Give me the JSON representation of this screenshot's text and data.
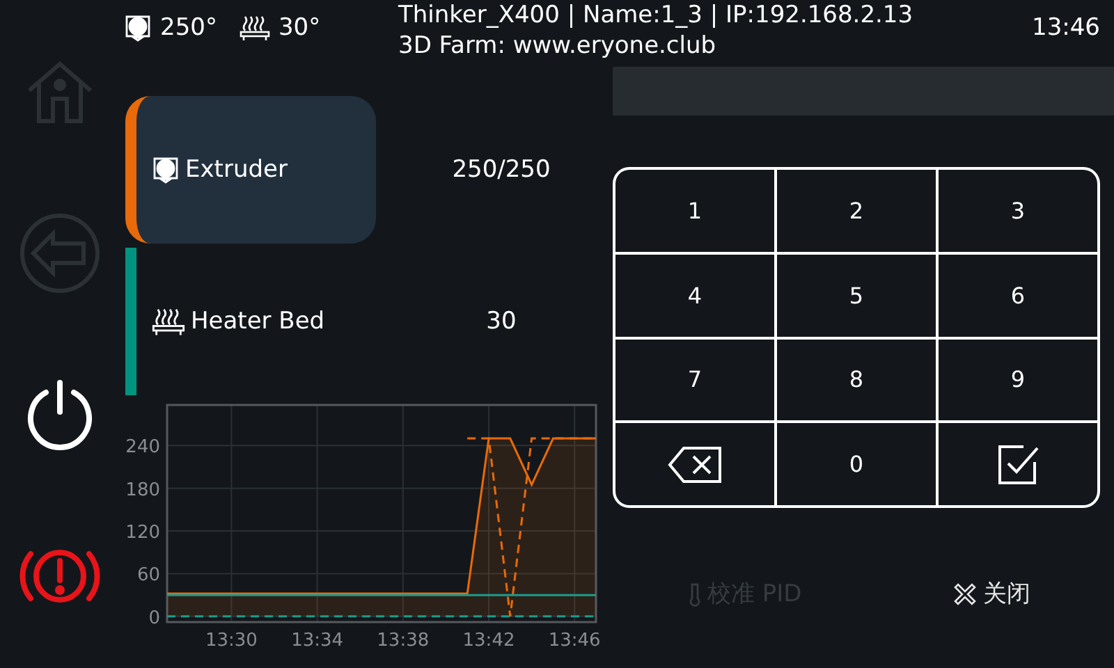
{
  "status_bar": {
    "extruder_temp": "250°",
    "bed_temp": "30°",
    "title": "Thinker_X400 | Name:1_3 | IP:192.168.2.13",
    "subtitle": "3D Farm: www.eryone.club",
    "time": "13:46"
  },
  "sidebar": [
    {
      "kind": "home",
      "disabled": true
    },
    {
      "kind": "back",
      "disabled": true
    },
    {
      "kind": "power",
      "disabled": false
    },
    {
      "kind": "emergency",
      "disabled": false
    }
  ],
  "heaters": [
    {
      "kind": "extruder",
      "name": "Extruder",
      "value": "250/250",
      "selected": true,
      "color": "#e86a0a"
    },
    {
      "kind": "bed",
      "name": "Heater Bed",
      "value": "30",
      "selected": false,
      "color": "#009480"
    }
  ],
  "chart": {
    "chart_data": {
      "type": "line",
      "grid": true,
      "categories": [
        null,
        null,
        null,
        "13:30",
        null,
        null,
        null,
        "13:34",
        null,
        null,
        null,
        "13:38",
        null,
        null,
        null,
        "13:42",
        null,
        null,
        null,
        "13:46",
        null
      ],
      "ylim": [
        -8,
        297
      ],
      "yticks": [
        0,
        60,
        120,
        180,
        240
      ],
      "series": [
        {
          "color": "#e86a0a",
          "type": "area",
          "values": [
            32,
            32,
            32,
            32,
            32,
            32,
            32,
            32,
            32,
            32,
            32,
            32,
            32,
            32,
            32,
            250,
            250,
            185,
            250,
            250,
            250
          ]
        },
        {
          "color": "#e86a0a",
          "line_style": "dashed",
          "values": [
            null,
            null,
            null,
            null,
            null,
            null,
            null,
            null,
            null,
            null,
            null,
            null,
            null,
            null,
            250,
            250,
            0,
            250,
            250,
            250,
            250
          ]
        },
        {
          "color": "#1a9c8c",
          "values": [
            30,
            30,
            30,
            30,
            30,
            30,
            30,
            30,
            30,
            30,
            30,
            30,
            30,
            30,
            30,
            30,
            30,
            30,
            30,
            30,
            30
          ]
        },
        {
          "color": "#1a9c8c",
          "line_style": "dashed",
          "values": [
            0,
            0,
            0,
            0,
            0,
            0,
            0,
            0,
            0,
            0,
            0,
            0,
            0,
            0,
            0,
            0,
            0,
            0,
            0,
            0,
            0
          ]
        }
      ]
    }
  },
  "keypad": [
    {
      "kind": "digit",
      "label": "1"
    },
    {
      "kind": "digit",
      "label": "2"
    },
    {
      "kind": "digit",
      "label": "3"
    },
    {
      "kind": "digit",
      "label": "4"
    },
    {
      "kind": "digit",
      "label": "5"
    },
    {
      "kind": "digit",
      "label": "6"
    },
    {
      "kind": "digit",
      "label": "7"
    },
    {
      "kind": "digit",
      "label": "8"
    },
    {
      "kind": "digit",
      "label": "9"
    },
    {
      "kind": "backspace"
    },
    {
      "kind": "digit",
      "label": "0"
    },
    {
      "kind": "confirm"
    }
  ],
  "actions": [
    {
      "kind": "pid",
      "label": "校准 PID",
      "disabled": true
    },
    {
      "kind": "close",
      "label": "关闭",
      "disabled": false
    }
  ]
}
